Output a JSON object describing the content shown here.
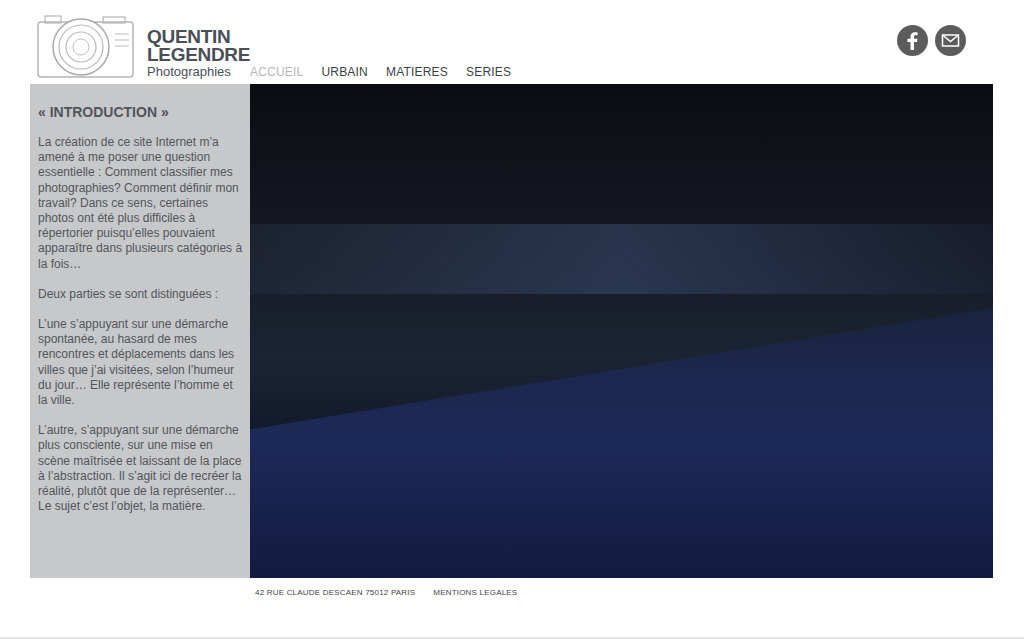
{
  "brand": {
    "first_name": "QUENTIN",
    "last_name": "LEGENDRE",
    "subtitle": "Photographies"
  },
  "nav": [
    {
      "label": "ACCUEIL",
      "selected": true
    },
    {
      "label": "URBAIN",
      "selected": false
    },
    {
      "label": "MATIERES",
      "selected": false
    },
    {
      "label": "SERIES",
      "selected": false
    }
  ],
  "sidebar": {
    "title": "« INTRODUCTION »",
    "paragraphs": [
      "La création de ce site Internet m’a amené à me poser une question essentielle : Comment classifier mes photographies? Comment définir mon travail? Dans ce sens, certaines photos ont été plus difficiles à répertorier puisqu’elles pouvaient apparaître dans plusieurs catégories à la fois…",
      "Deux parties se sont distinguées :",
      "L’une s’appuyant sur une démarche spontanée, au hasard de mes rencontres et déplacements dans les villes que j’ai visitées, selon l’humeur du jour… Elle représente l’homme et la ville.",
      "L’autre, s’appuyant sur une démarche plus consciente, sur une mise en scène maîtrisée et laissant de la place à l’abstraction. Il s’agit ici de recréer la réalité, plutôt que de la représenter… Le sujet c’est l’objet, la matière."
    ]
  },
  "footer": {
    "address": "42 RUE CLAUDE DESCAEN 75012 PARIS",
    "legal": "MENTIONS LEGALES"
  }
}
